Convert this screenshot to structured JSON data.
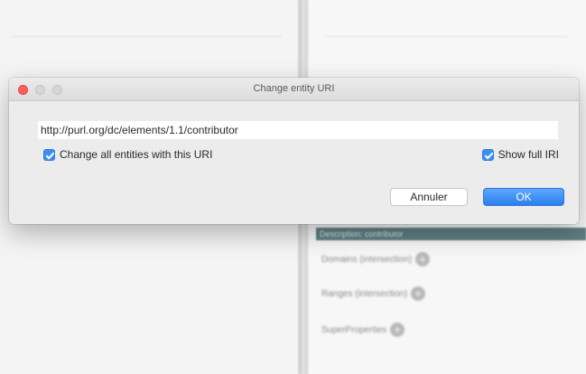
{
  "dialog": {
    "title": "Change entity URI",
    "uri_value": "http://purl.org/dc/elements/1.1/contributor",
    "change_all_label": "Change all entities with this URI",
    "change_all_checked": true,
    "show_full_iri_label": "Show full IRI",
    "show_full_iri_checked": true,
    "cancel_label": "Annuler",
    "ok_label": "OK"
  },
  "background": {
    "section_header": "Description: contributor",
    "properties": [
      {
        "label": "Domains (intersection)"
      },
      {
        "label": "Ranges (intersection)"
      },
      {
        "label": "SuperProperties"
      }
    ]
  },
  "colors": {
    "accent": "#3c8ef0",
    "ok_button": "#2a7ff0",
    "close_light": "#fc605c",
    "section_header": "#5f7f82"
  }
}
